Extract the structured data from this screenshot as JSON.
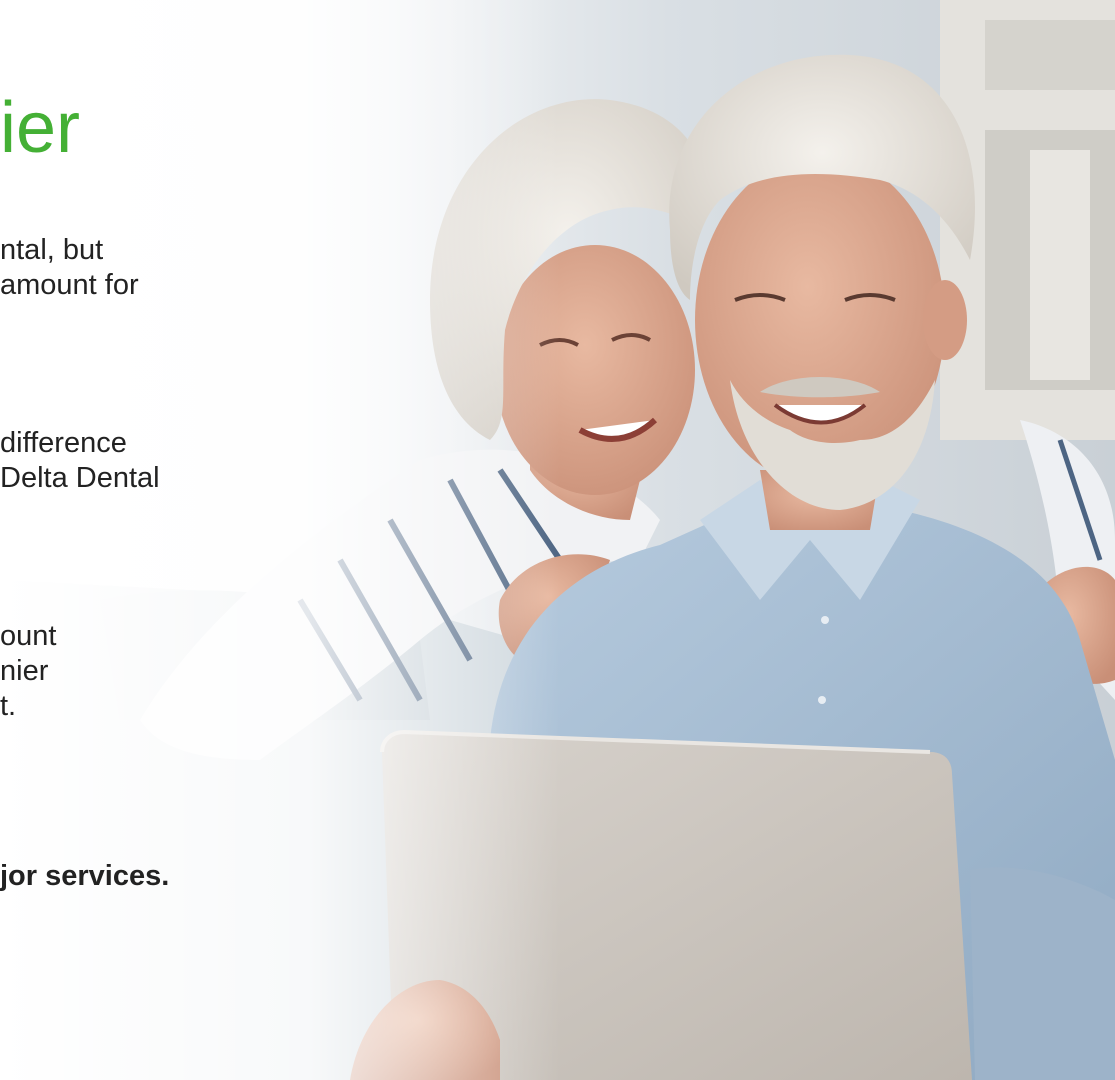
{
  "heading": "ier",
  "paragraphs": [
    {
      "lines": [
        "ntal, but",
        "amount for"
      ]
    },
    {
      "lines": [
        "difference",
        " Delta Dental"
      ]
    },
    {
      "lines": [
        "ount",
        "nier",
        "t."
      ]
    },
    {
      "lines": [
        "jor services."
      ]
    }
  ],
  "colors": {
    "accent": "#44b035",
    "text": "#222222"
  }
}
